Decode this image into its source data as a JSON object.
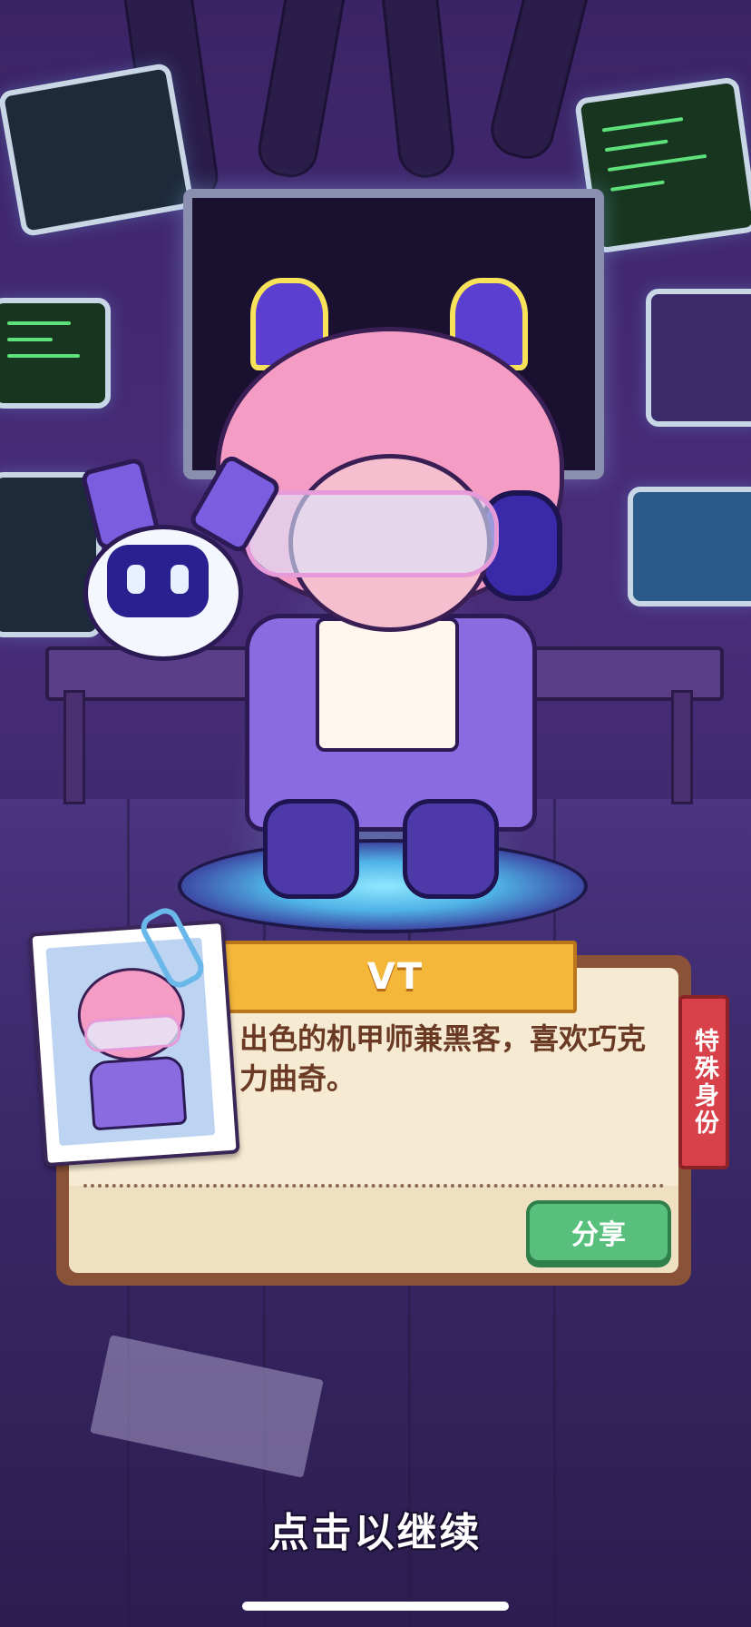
{
  "character": {
    "name": "VT",
    "description": "出色的机甲师兼黑客，喜欢巧克力曲奇。",
    "tag": "特殊身份"
  },
  "actions": {
    "share_label": "分享",
    "continue_label": "点击以继续"
  },
  "colors": {
    "ribbon": "#f4b73a",
    "card": "#f7ead3",
    "share_button": "#58c07c",
    "tag": "#d8404a"
  }
}
